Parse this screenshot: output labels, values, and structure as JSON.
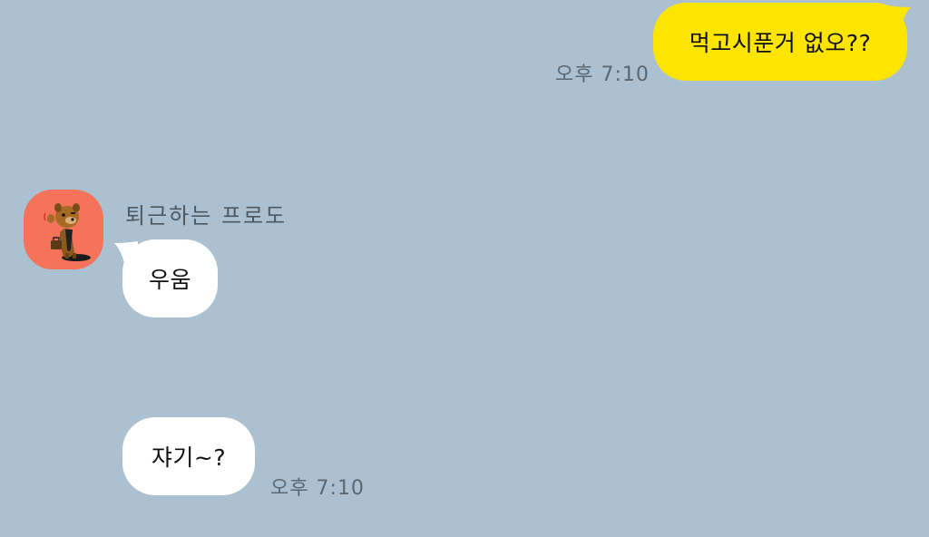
{
  "colors": {
    "background": "#abc1d1",
    "outgoing_bubble": "#fee500",
    "incoming_bubble": "#ffffff",
    "avatar_bg": "#f4735a",
    "timestamp": "#5d6770"
  },
  "messages": {
    "outgoing_1": {
      "text": "먹고시푼거 없오??",
      "time": "오후 7:10"
    },
    "incoming_group": {
      "sender_name": "퇴근하는 프로도",
      "avatar_icon": "frodo-dog-avatar-icon",
      "items": [
        {
          "text": "우움"
        },
        {
          "text": "쟈기~?",
          "time": "오후 7:10"
        }
      ]
    }
  }
}
